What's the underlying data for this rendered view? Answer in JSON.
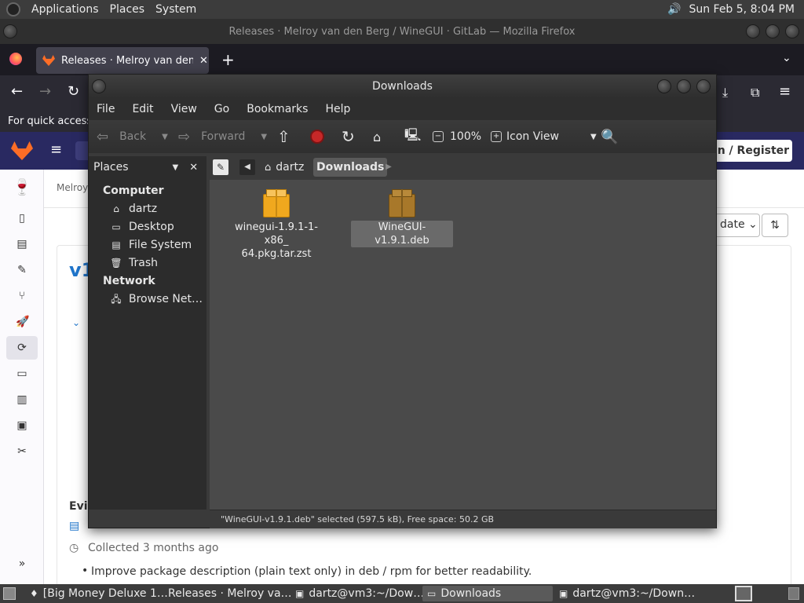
{
  "top_panel": {
    "menu": [
      "Applications",
      "Places",
      "System"
    ],
    "clock": "Sun Feb  5,  8:04 PM"
  },
  "firefox": {
    "window_title": "Releases · Melroy van den Berg / WineGUI · GitLab — Mozilla Firefox",
    "tab_title": "Releases · Melroy van den Be",
    "bookmarks_text": "For quick access,",
    "gitlab": {
      "breadcrumb": "Melroy",
      "sign_in": "in / Register",
      "sort": "date",
      "heading_fragment": "v1",
      "evidence_fragment": "Evi",
      "collected": "Collected 3 months ago",
      "bullet": "Improve package description (plain text only) in deb / rpm for better readability."
    }
  },
  "nautilus": {
    "title": "Downloads",
    "menu": [
      "File",
      "Edit",
      "View",
      "Go",
      "Bookmarks",
      "Help"
    ],
    "toolbar": {
      "back": "Back",
      "forward": "Forward",
      "zoom": "100%",
      "view_mode": "Icon View"
    },
    "places_label": "Places",
    "sidebar": {
      "computer_header": "Computer",
      "computer_items": [
        {
          "label": "dartz",
          "icon": "home-icon"
        },
        {
          "label": "Desktop",
          "icon": "desktop-icon"
        },
        {
          "label": "File System",
          "icon": "drive-icon"
        },
        {
          "label": "Trash",
          "icon": "trash-icon"
        }
      ],
      "network_header": "Network",
      "network_items": [
        {
          "label": "Browse Net…",
          "icon": "network-icon"
        }
      ]
    },
    "pathbar": [
      "dartz",
      "Downloads"
    ],
    "files": [
      {
        "line1": "winegui-1.9.1-1-x86_",
        "line2": "64.pkg.tar.zst",
        "selected": false
      },
      {
        "line1": "WineGUI-v1.9.1.deb",
        "line2": "",
        "selected": true
      }
    ],
    "status": "\"WineGUI-v1.9.1.deb\" selected (597.5 kB), Free space: 50.2 GB"
  },
  "taskbar": {
    "tasks": [
      "[Big Money Deluxe 1…",
      "Releases · Melroy va…",
      "dartz@vm3:~/Dow…",
      "Downloads",
      "dartz@vm3:~/Down…"
    ]
  },
  "colors": {
    "gitlab_header": "#292961",
    "firefox_dark": "#1c1b22",
    "nautilus_bg": "#4a4a4a",
    "stop_red": "#c62828"
  }
}
